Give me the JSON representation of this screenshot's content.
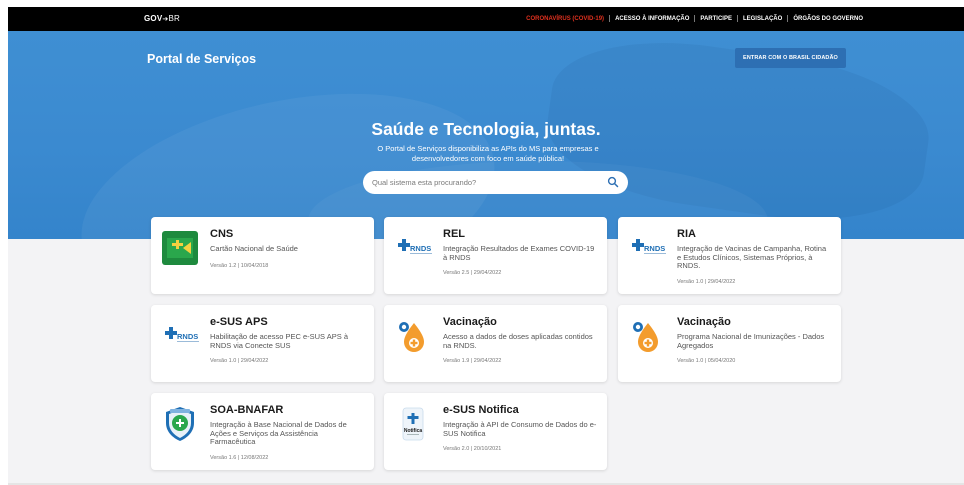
{
  "govbar": {
    "logo": "GOV",
    "logo_suffix": "BR",
    "links": [
      "CORONAVÍRUS (COVID-19)",
      "ACESSO À INFORMAÇÃO",
      "PARTICIPE",
      "LEGISLAÇÃO",
      "ÓRGÃOS DO GOVERNO"
    ],
    "covid_color": "#e0301e"
  },
  "header": {
    "title": "Portal de Serviços",
    "login_button": "ENTRAR COM O BRASIL CIDADÃO"
  },
  "hero": {
    "heading": "Saúde e Tecnologia, juntas.",
    "subheading": "O Portal de Serviços disponibiliza as APIs do MS para empresas e desenvolvedores com foco em saúde pública!",
    "search_placeholder": "Qual sistema esta procurando?"
  },
  "colors": {
    "hero_blue": "#3b8ad0",
    "button_blue": "#2d6fb3",
    "rnds_blue": "#1f6fb5",
    "vacina_orange": "#f39c2d"
  },
  "cards": [
    {
      "title": "CNS",
      "desc": "Cartão Nacional de Saúde",
      "version": "Versão 1.2 | 10/04/2018",
      "icon": "cns-logo-icon"
    },
    {
      "title": "REL",
      "desc": "Integração Resultados de Exames COVID-19 à RNDS",
      "version": "Versão 2.5 | 29/04/2022",
      "icon": "rnds-logo-icon",
      "logo_text": "RNDS"
    },
    {
      "title": "RIA",
      "desc": "Integração de Vacinas de Campanha, Rotina e Estudos Clínicos, Sistemas Próprios, à RNDS.",
      "version": "Versão 1.0 | 29/04/2022",
      "icon": "rnds-logo-icon",
      "logo_text": "RNDS"
    },
    {
      "title": "e-SUS APS",
      "desc": "Habilitação de acesso PEC e-SUS APS à RNDS via Conecte SUS",
      "version": "Versão 1.0 | 29/04/2022",
      "icon": "rnds-logo-icon",
      "logo_text": "RNDS"
    },
    {
      "title": "Vacinação",
      "desc": "Acesso a dados de doses aplicadas contidos na RNDS.",
      "version": "Versão 1.9 | 29/04/2022",
      "icon": "vaccine-drop-icon"
    },
    {
      "title": "Vacinação",
      "desc": "Programa Nacional de Imunizações - Dados Agregados",
      "version": "Versão 1.0 | 05/04/2020",
      "icon": "vaccine-drop-icon"
    },
    {
      "title": "SOA-BNAFAR",
      "desc": "Integração à Base Nacional de Dados de Ações e Serviços da Assistência Farmacêutica",
      "version": "Versão 1.6 | 12/08/2022",
      "icon": "bnafar-shield-icon"
    },
    {
      "title": "e-SUS Notifica",
      "desc": "Integração à API de Consumo de Dados do e-SUS Notifica",
      "version": "Versão 2.0 | 20/10/2021",
      "icon": "notifica-logo-icon",
      "logo_text": "Notifica"
    }
  ]
}
